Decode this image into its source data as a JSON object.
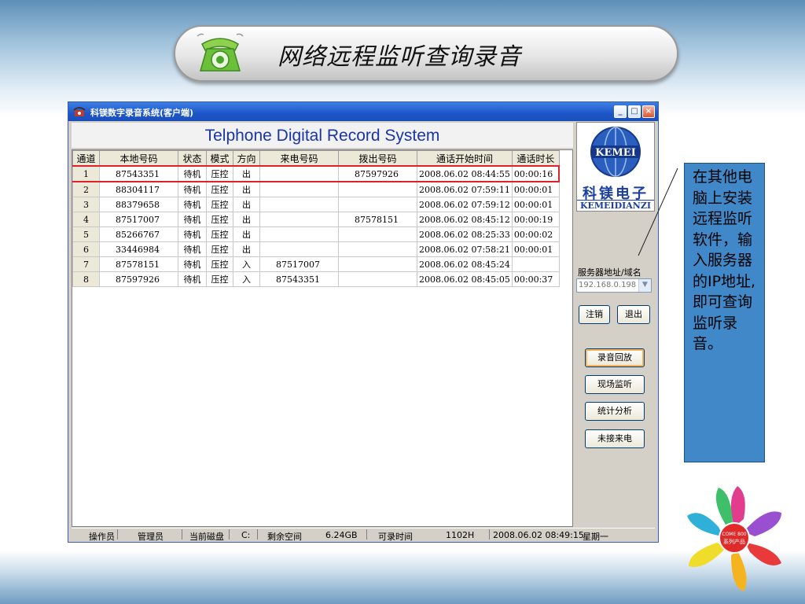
{
  "slide": {
    "title": "网络远程监听查询录音",
    "note": "在其他电脑上安装远程监听软件，输入服务器的IP地址,即可查询监听录音。"
  },
  "window": {
    "title": "科镁数字录音系统(客户端)",
    "app_title": "Telphone Digital Record System",
    "controls": {
      "minimize": "_",
      "maximize": "□",
      "close": "×"
    }
  },
  "table": {
    "headers": [
      "通道",
      "本地号码",
      "状态",
      "模式",
      "方向",
      "来电号码",
      "拨出号码",
      "通话开始时间",
      "通话时长"
    ],
    "rows": [
      {
        "ch": "1",
        "local": "87543351",
        "status": "待机",
        "mode": "压控",
        "dir": "出",
        "incoming": "",
        "outgoing": "87597926",
        "start": "2008.06.02 08:44:55",
        "dur": "00:00:16"
      },
      {
        "ch": "2",
        "local": "88304117",
        "status": "待机",
        "mode": "压控",
        "dir": "出",
        "incoming": "",
        "outgoing": "",
        "start": "2008.06.02 07:59:11",
        "dur": "00:00:01"
      },
      {
        "ch": "3",
        "local": "88379658",
        "status": "待机",
        "mode": "压控",
        "dir": "出",
        "incoming": "",
        "outgoing": "",
        "start": "2008.06.02 07:59:12",
        "dur": "00:00:01"
      },
      {
        "ch": "4",
        "local": "87517007",
        "status": "待机",
        "mode": "压控",
        "dir": "出",
        "incoming": "",
        "outgoing": "87578151",
        "start": "2008.06.02 08:45:12",
        "dur": "00:00:19"
      },
      {
        "ch": "5",
        "local": "85266767",
        "status": "待机",
        "mode": "压控",
        "dir": "出",
        "incoming": "",
        "outgoing": "",
        "start": "2008.06.02 08:25:33",
        "dur": "00:00:02"
      },
      {
        "ch": "6",
        "local": "33446984",
        "status": "待机",
        "mode": "压控",
        "dir": "出",
        "incoming": "",
        "outgoing": "",
        "start": "2008.06.02 07:58:21",
        "dur": "00:00:01"
      },
      {
        "ch": "7",
        "local": "87578151",
        "status": "待机",
        "mode": "压控",
        "dir": "入",
        "incoming": "87517007",
        "outgoing": "",
        "start": "2008.06.02 08:45:24",
        "dur": ""
      },
      {
        "ch": "8",
        "local": "87597926",
        "status": "待机",
        "mode": "压控",
        "dir": "入",
        "incoming": "87543351",
        "outgoing": "",
        "start": "2008.06.02 08:45:05",
        "dur": "00:00:37"
      }
    ],
    "selected_row": "1"
  },
  "sidebar": {
    "logo_text": "KEMEI",
    "logo_cn": "科镁电子",
    "logo_en": "KEMEIDIANZI",
    "server_label": "服务器地址/域名",
    "server_value": "192.168.0.198",
    "logout_label": "注销",
    "exit_label": "退出",
    "buttons": [
      "录音回放",
      "现场监听",
      "统计分析",
      "未接来电"
    ]
  },
  "statusbar": {
    "operator_label": "操作员",
    "operator": "管理员",
    "disk_label": "当前磁盘",
    "disk": "C:",
    "free_label": "剩余空间",
    "free": "6.24GB",
    "rec_label": "可录时间",
    "rec": "1102H",
    "datetime": "2008.06.02  08:49:15",
    "weekday": "星期一"
  },
  "emblem": {
    "center_top": "COME 800",
    "center_bottom": "系列产品"
  },
  "colors": {
    "accent_blue": "#1a35a8",
    "note_bg": "#4088c8",
    "selection_red": "#e0202a",
    "titlebar": "#1c56c8"
  }
}
